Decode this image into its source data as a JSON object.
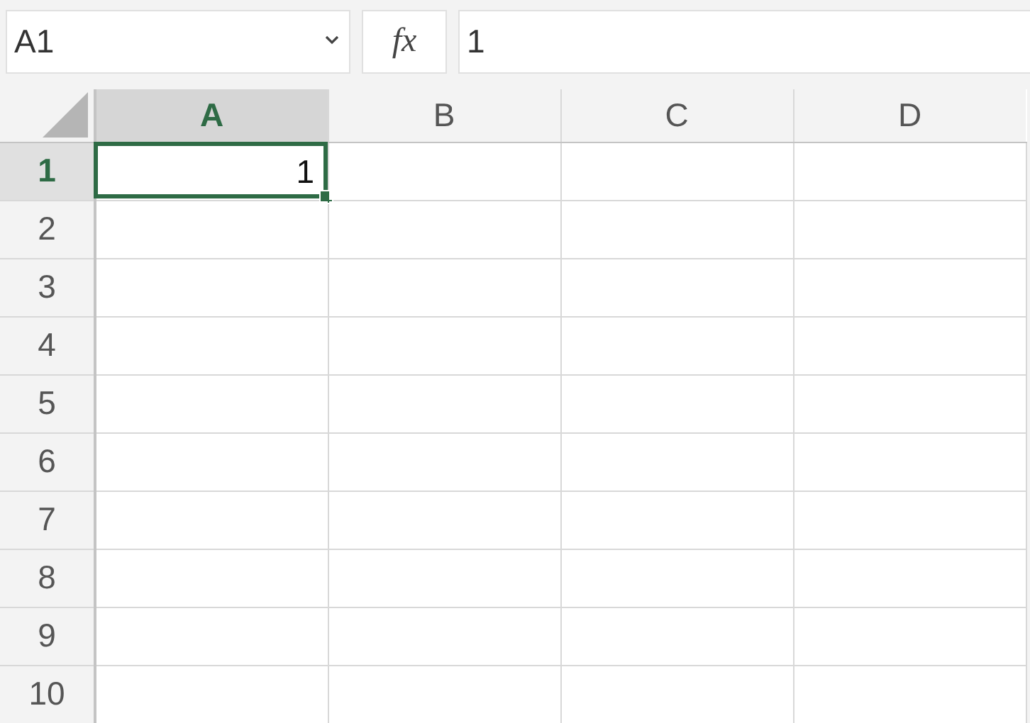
{
  "name_box": {
    "value": "A1"
  },
  "function_button": {
    "label": "fx"
  },
  "formula_bar": {
    "value": "1"
  },
  "columns": [
    {
      "label": "A",
      "selected": true
    },
    {
      "label": "B",
      "selected": false
    },
    {
      "label": "C",
      "selected": false
    },
    {
      "label": "D",
      "selected": false
    }
  ],
  "rows": [
    {
      "label": "1",
      "selected": true,
      "cells": [
        {
          "value": "1",
          "selected": true
        }
      ]
    },
    {
      "label": "2",
      "selected": false
    },
    {
      "label": "3",
      "selected": false
    },
    {
      "label": "4",
      "selected": false
    },
    {
      "label": "5",
      "selected": false
    },
    {
      "label": "6",
      "selected": false
    },
    {
      "label": "7",
      "selected": false
    },
    {
      "label": "8",
      "selected": false
    },
    {
      "label": "9",
      "selected": false
    },
    {
      "label": "10",
      "selected": false
    }
  ]
}
